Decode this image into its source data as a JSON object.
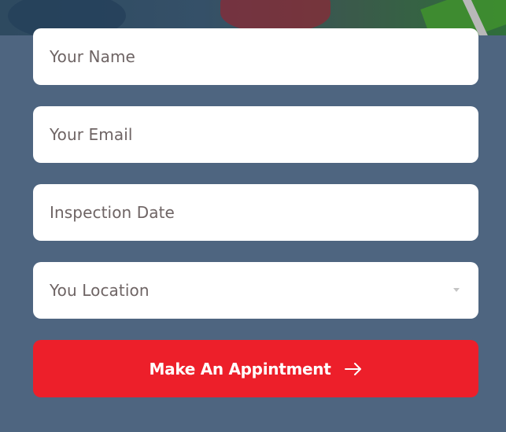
{
  "form": {
    "name_placeholder": "Your Name",
    "email_placeholder": "Your Email",
    "date_placeholder": "Inspection Date",
    "location_placeholder": "You Location",
    "submit_label": "Make An Appintment"
  },
  "icons": {
    "dropdown": "chevron-down-icon",
    "submit": "arrow-right-icon"
  },
  "colors": {
    "background": "#4e6580",
    "field": "#ffffff",
    "placeholder_text": "#6e6464",
    "submit_button": "#ed1f2a",
    "submit_text": "#ffffff"
  }
}
